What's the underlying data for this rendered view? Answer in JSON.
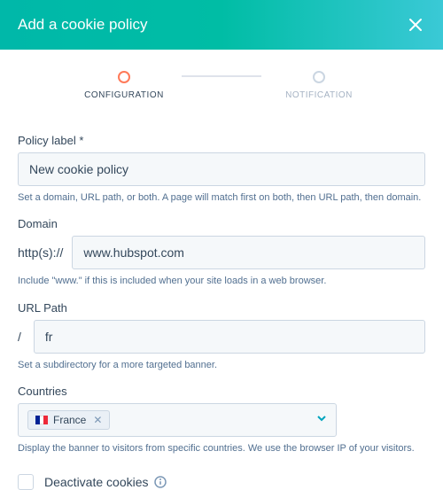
{
  "header": {
    "title": "Add a cookie policy"
  },
  "stepper": {
    "configuration": "CONFIGURATION",
    "notification": "NOTIFICATION"
  },
  "policyLabel": {
    "label": "Policy label *",
    "value": "New cookie policy",
    "helper": "Set a domain, URL path, or both. A page will match first on both, then URL path, then domain."
  },
  "domain": {
    "label": "Domain",
    "prefix": "http(s)://",
    "value": "www.hubspot.com",
    "helper": "Include \"www.\" if this is included when your site loads in a web browser."
  },
  "urlPath": {
    "label": "URL Path",
    "prefix": "/",
    "value": "fr",
    "helper": "Set a subdirectory for a more targeted banner."
  },
  "countries": {
    "label": "Countries",
    "selected": "France",
    "helper": "Display the banner to visitors from specific countries. We use the browser IP of your visitors."
  },
  "deactivate": {
    "label": "Deactivate cookies"
  }
}
